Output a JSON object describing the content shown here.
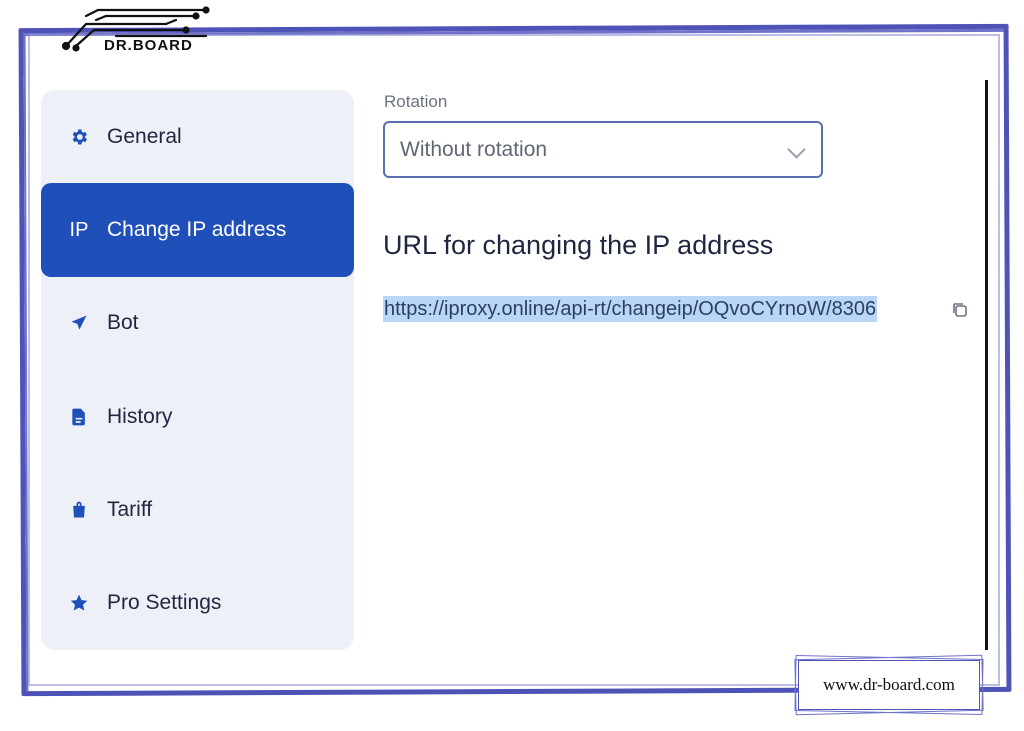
{
  "brand": {
    "logo_text": "DR.BOARD",
    "watermark": "www.dr-board.com"
  },
  "sidebar": {
    "items": [
      {
        "label": "General",
        "icon": "gear-icon",
        "active": false
      },
      {
        "label": "Change IP address",
        "icon": "ip-icon",
        "icon_text": "IP",
        "active": true
      },
      {
        "label": "Bot",
        "icon": "paper-plane-icon",
        "active": false
      },
      {
        "label": "History",
        "icon": "document-icon",
        "active": false
      },
      {
        "label": "Tariff",
        "icon": "shopping-bag-icon",
        "active": false
      },
      {
        "label": "Pro Settings",
        "icon": "star-icon",
        "active": false
      }
    ]
  },
  "main": {
    "rotation": {
      "label": "Rotation",
      "value": "Without rotation"
    },
    "url_section": {
      "heading": "URL for changing the IP address",
      "url": "https://iproxy.online/api-rt/changeip/OQvoCYrnoW/8306"
    }
  },
  "colors": {
    "accent": "#1f4fb8",
    "sidebar_bg": "#eef0f7",
    "frame": "#4f53b8",
    "selection": "#b9d6f6"
  }
}
